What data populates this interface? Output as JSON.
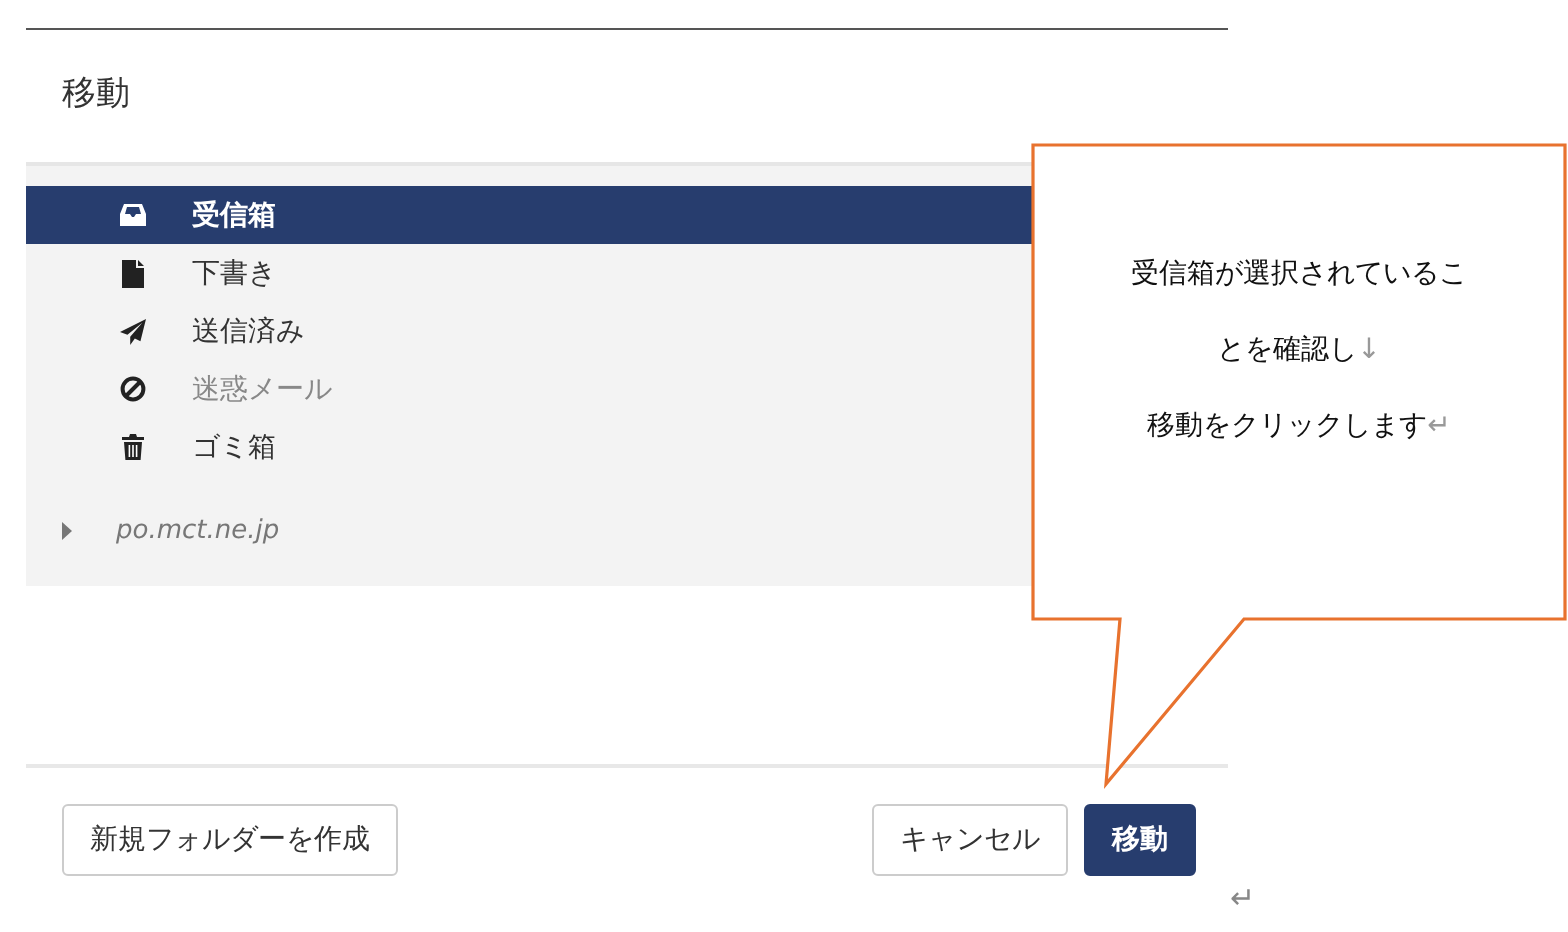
{
  "dialog": {
    "title": "移動",
    "folders": [
      {
        "label": "受信箱",
        "kind": "inbox",
        "selected": true,
        "disabled": false
      },
      {
        "label": "下書き",
        "kind": "draft",
        "selected": false,
        "disabled": false
      },
      {
        "label": "送信済み",
        "kind": "sent",
        "selected": false,
        "disabled": false
      },
      {
        "label": "迷惑メール",
        "kind": "junk",
        "selected": false,
        "disabled": true
      },
      {
        "label": "ゴミ箱",
        "kind": "trash",
        "selected": false,
        "disabled": false
      }
    ],
    "account": {
      "label": "po.mct.ne.jp",
      "expanded": false
    },
    "buttons": [
      {
        "label": "新規フォルダーを作成",
        "kind": "secondary"
      },
      {
        "label": "キャンセル",
        "kind": "secondary"
      },
      {
        "label": "移動",
        "kind": "primary"
      }
    ]
  },
  "callout": {
    "lines": [
      {
        "text": "受信箱が選択されているこ"
      },
      {
        "text": "とを確認し",
        "mark": "↓"
      },
      {
        "text": "移動をクリックします",
        "mark": "↵"
      }
    ]
  },
  "paragraph_mark": "↵"
}
